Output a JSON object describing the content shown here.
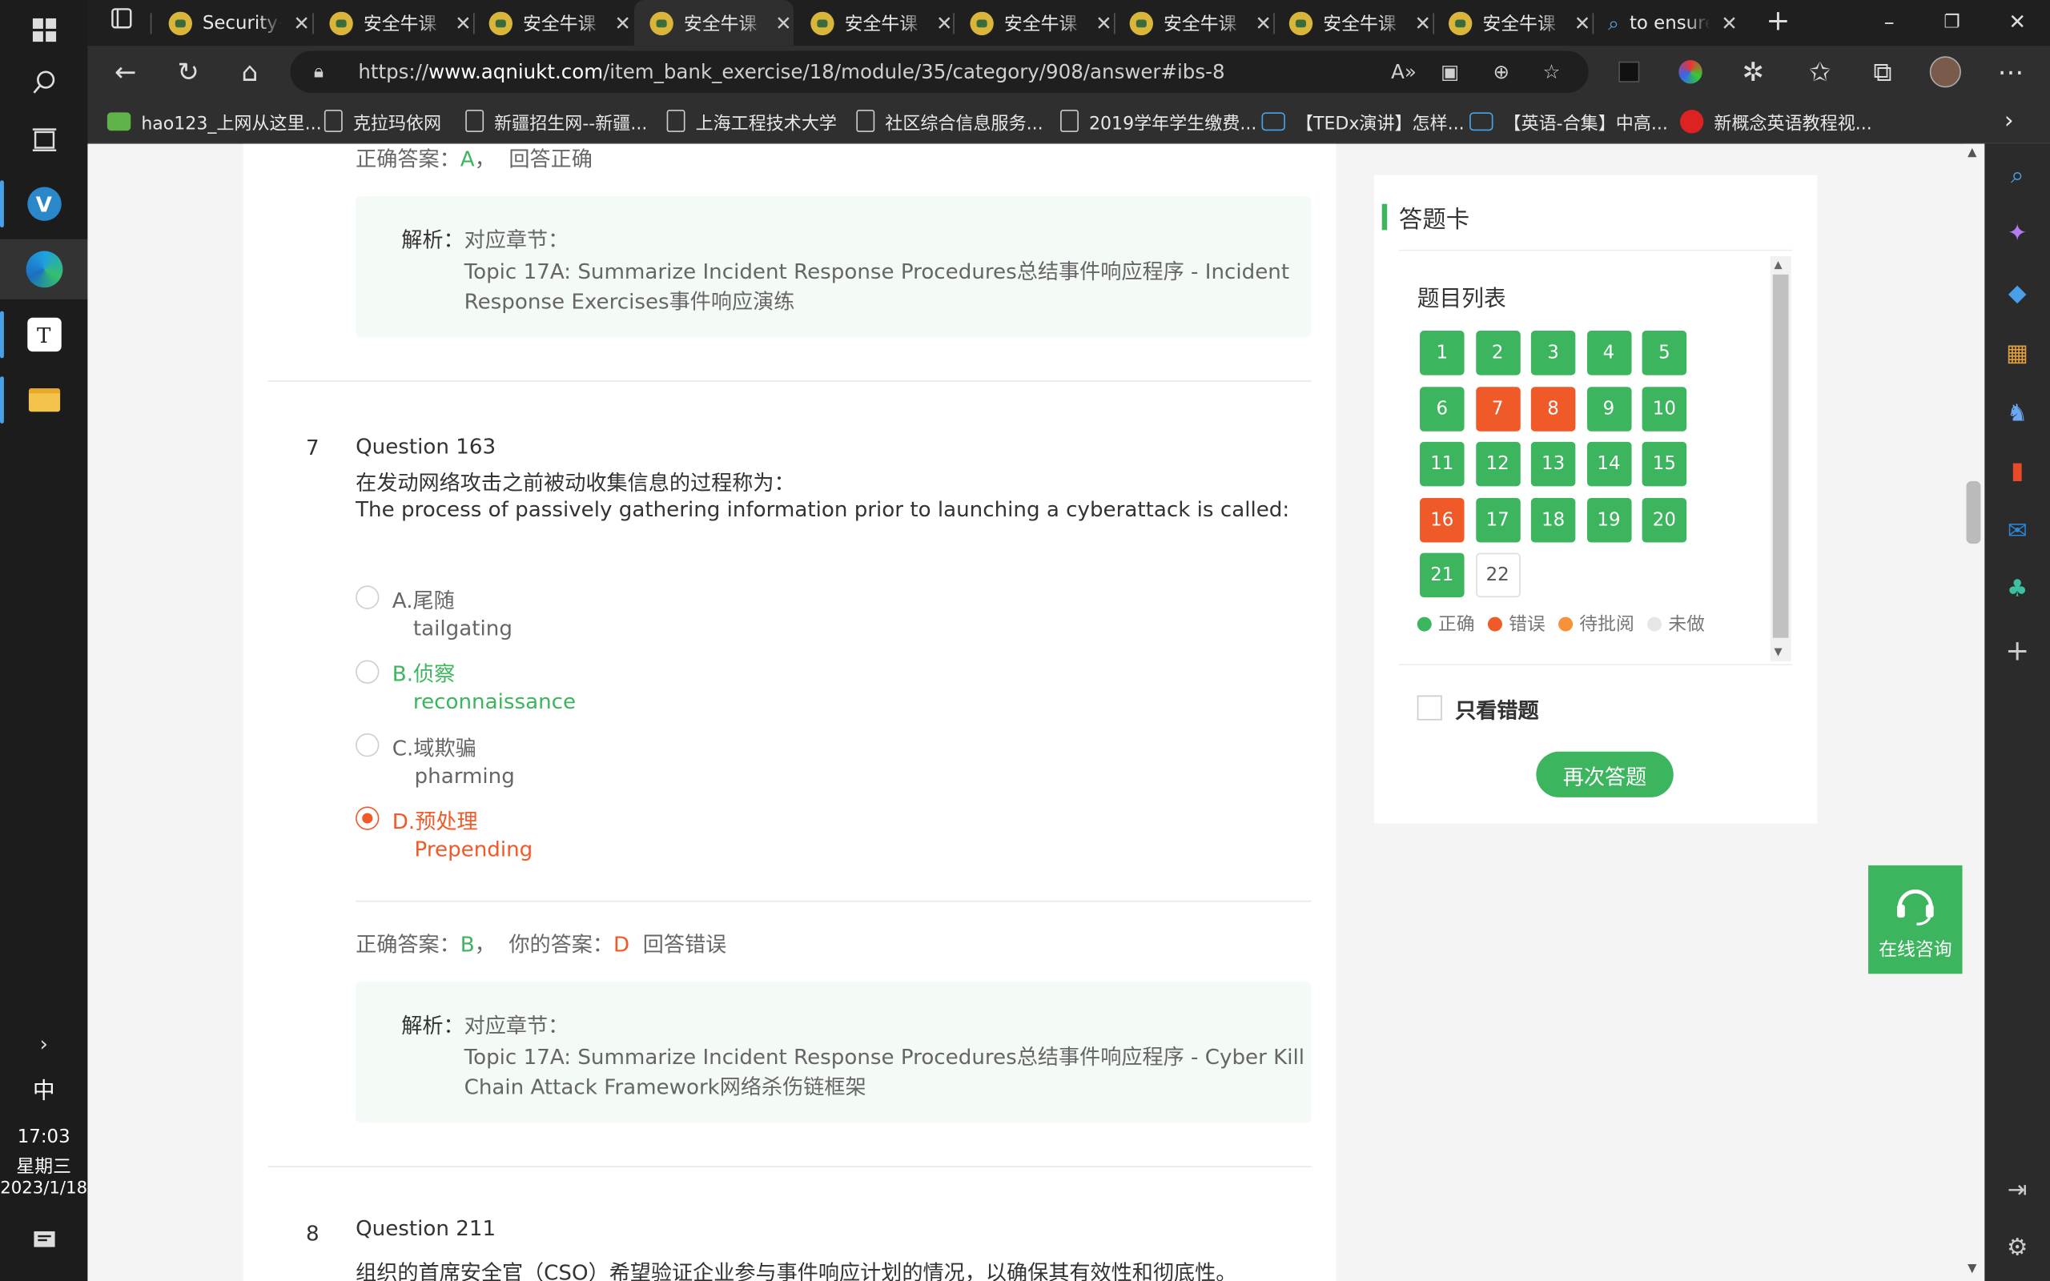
{
  "taskbar": {
    "clock_time": "17:03",
    "clock_weekday": "星期三",
    "clock_date": "2023/1/18",
    "ime": "中"
  },
  "tabs": [
    {
      "title": "Security+"
    },
    {
      "title": "安全牛课"
    },
    {
      "title": "安全牛课"
    },
    {
      "title": "安全牛课",
      "active": true
    },
    {
      "title": "安全牛课"
    },
    {
      "title": "安全牛课"
    },
    {
      "title": "安全牛课"
    },
    {
      "title": "安全牛课"
    },
    {
      "title": "安全牛课"
    },
    {
      "title": "to ensure"
    }
  ],
  "address": {
    "url_prefix": "https://",
    "url_host": "www.aqniukt.com",
    "url_path": "/item_bank_exercise/18/module/35/category/908/answer#ibs-8"
  },
  "bookmarks": [
    {
      "label": "hao123_上网从这里..."
    },
    {
      "label": "克拉玛依网"
    },
    {
      "label": "新疆招生网--新疆..."
    },
    {
      "label": "上海工程技术大学"
    },
    {
      "label": "社区综合信息服务..."
    },
    {
      "label": "2019学年学生缴费..."
    },
    {
      "label": "【TEDx演讲】怎样..."
    },
    {
      "label": "【英语-合集】中高..."
    },
    {
      "label": "新概念英语教程视..."
    }
  ],
  "prev_question": {
    "correct_label": "正确答案：",
    "correct_value": "A",
    "comma": "，",
    "result": "回答正确",
    "analysis_label": "解析：",
    "chapter_label": "对应章节：",
    "chapter_line1": "Topic 17A: Summarize Incident Response Procedures总结事件响应程序 - Incident",
    "chapter_line2": "Response Exercises事件响应演练"
  },
  "question7": {
    "number": "7",
    "title": "Question 163",
    "text_cn": "在发动网络攻击之前被动收集信息的过程称为：",
    "text_en": "The process of passively gathering information prior to launching a cyberattack is called:",
    "options": [
      {
        "cn": "A.尾随",
        "en": "tailgating"
      },
      {
        "cn": "B.侦察",
        "en": "reconnaissance"
      },
      {
        "cn": "C.域欺骗",
        "en": "pharming"
      },
      {
        "cn": "D.预处理",
        "en": "Prepending"
      }
    ],
    "correct_label": "正确答案：",
    "correct_value": "B",
    "comma": "，",
    "yours_label": "你的答案：",
    "yours_value": "D",
    "result": "回答错误",
    "analysis_label": "解析：",
    "chapter_label": "对应章节：",
    "chapter_line1": "Topic 17A: Summarize Incident Response Procedures总结事件响应程序 - Cyber Kill",
    "chapter_line2": "Chain Attack Framework网络杀伤链框架"
  },
  "question8": {
    "number": "8",
    "title": "Question 211",
    "text_cn": "组织的首席安全官（CSO）希望验证企业参与事件响应计划的情况，以确保其有效性和彻底性。"
  },
  "answer_card": {
    "title": "答题卡",
    "list_title": "题目列表",
    "items": [
      {
        "n": "1",
        "s": "correct"
      },
      {
        "n": "2",
        "s": "correct"
      },
      {
        "n": "3",
        "s": "correct"
      },
      {
        "n": "4",
        "s": "correct"
      },
      {
        "n": "5",
        "s": "correct"
      },
      {
        "n": "6",
        "s": "correct"
      },
      {
        "n": "7",
        "s": "wrong"
      },
      {
        "n": "8",
        "s": "wrong"
      },
      {
        "n": "9",
        "s": "correct"
      },
      {
        "n": "10",
        "s": "correct"
      },
      {
        "n": "11",
        "s": "correct"
      },
      {
        "n": "12",
        "s": "correct"
      },
      {
        "n": "13",
        "s": "correct"
      },
      {
        "n": "14",
        "s": "correct"
      },
      {
        "n": "15",
        "s": "correct"
      },
      {
        "n": "16",
        "s": "wrong"
      },
      {
        "n": "17",
        "s": "correct"
      },
      {
        "n": "18",
        "s": "correct"
      },
      {
        "n": "19",
        "s": "correct"
      },
      {
        "n": "20",
        "s": "correct"
      },
      {
        "n": "21",
        "s": "correct"
      },
      {
        "n": "22",
        "s": "undone"
      }
    ],
    "legend": [
      {
        "label": "正确",
        "color": "#3cb55e"
      },
      {
        "label": "错误",
        "color": "#f05a28"
      },
      {
        "label": "待批阅",
        "color": "#f7923a"
      },
      {
        "label": "未做",
        "color": "#e6e6e6"
      }
    ],
    "only_wrong_label": "只看错题",
    "retry_label": "再次答题"
  },
  "consult_label": "在线咨询",
  "colors": {
    "correct": "#3cb55e",
    "wrong": "#f05a28",
    "pending": "#f7923a",
    "undone": "#e6e6e6"
  }
}
